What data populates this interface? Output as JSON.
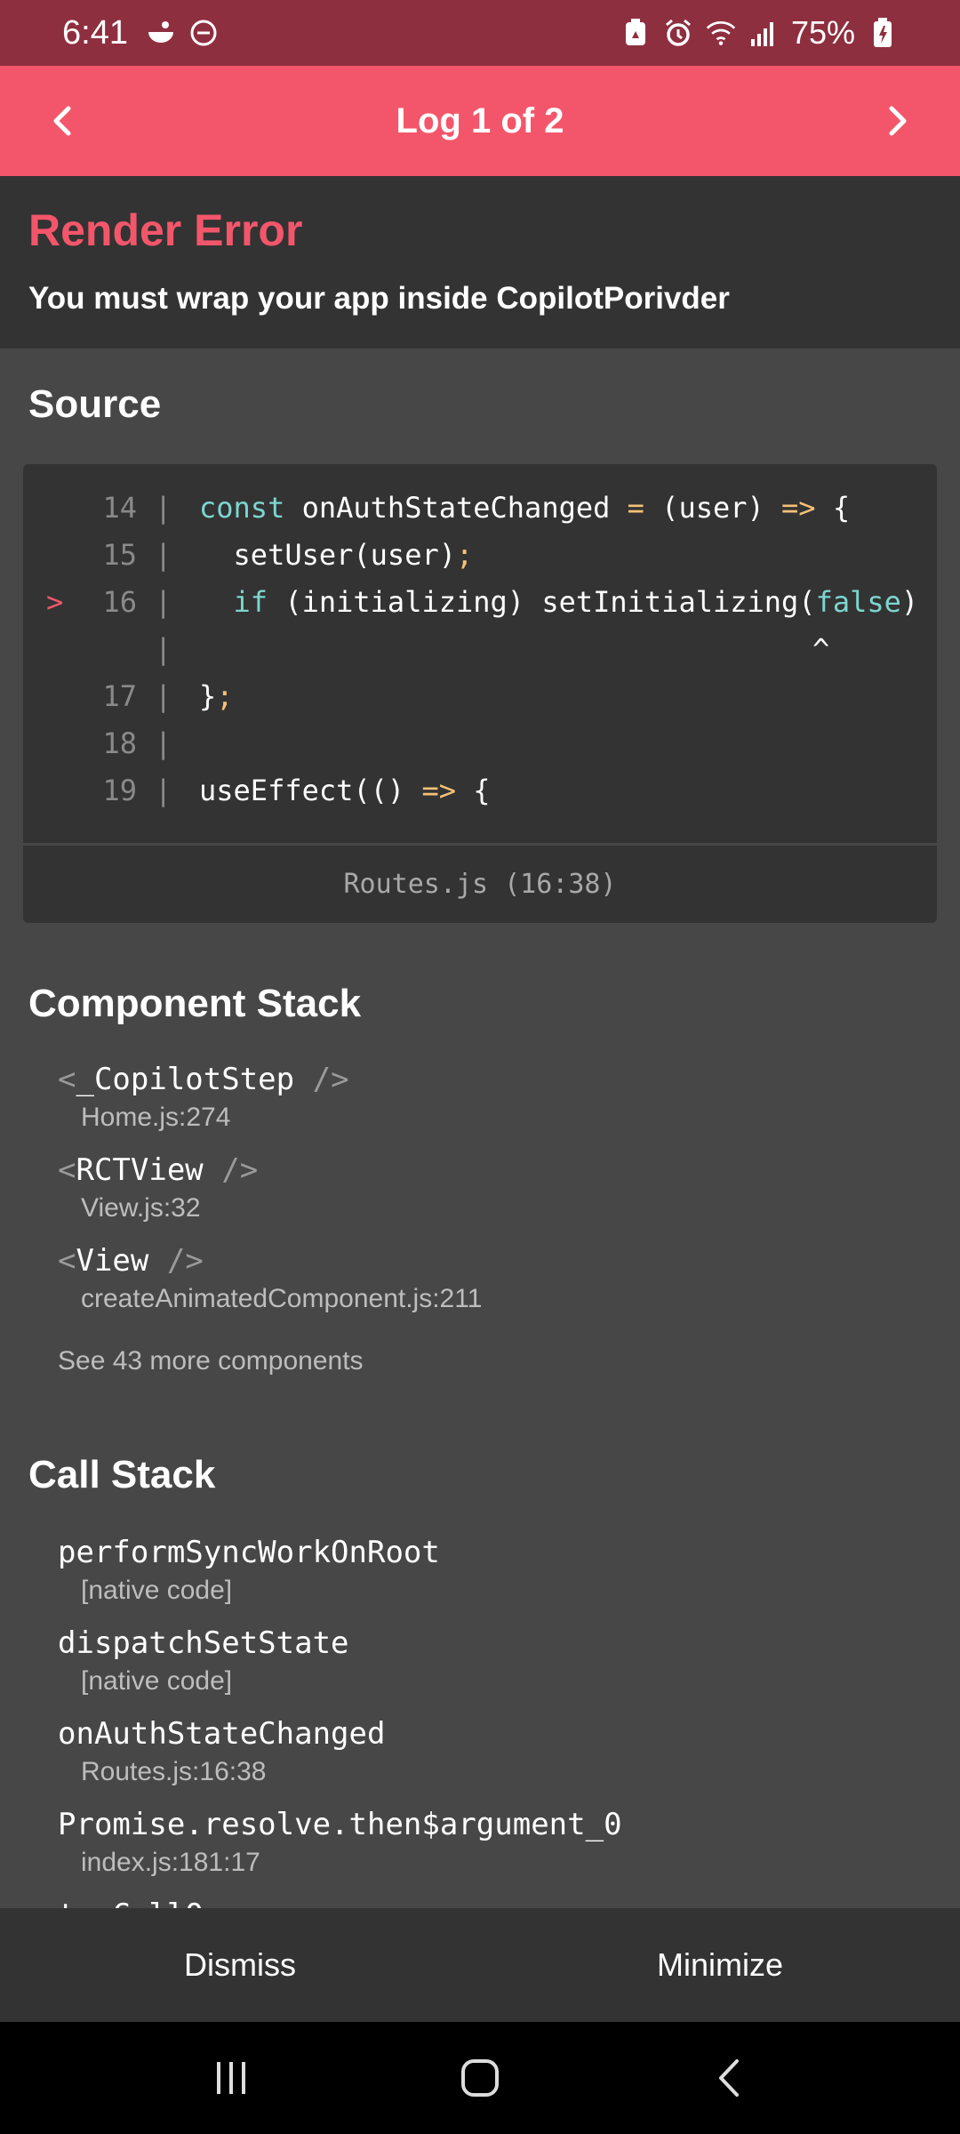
{
  "status_bar": {
    "time": "6:41",
    "battery": "75%",
    "left_icons": [
      "notification-icon",
      "do-not-disturb-icon"
    ],
    "right_icons": [
      "battery-saver-icon",
      "alarm-icon",
      "wifi-icon",
      "signal-icon",
      "battery-icon"
    ]
  },
  "header": {
    "title": "Log 1 of 2",
    "bg_color": "#f3566a"
  },
  "error": {
    "title": "Render Error",
    "message": "You must wrap your app inside CopilotPorivder"
  },
  "source": {
    "section_title": "Source",
    "lines": [
      {
        "num": "14",
        "marker": "",
        "code": "const onAuthStateChanged = (user) => {"
      },
      {
        "num": "15",
        "marker": "",
        "code": "  setUser(user);"
      },
      {
        "num": "16",
        "marker": ">",
        "code": "  if (initializing) setInitializing(false)"
      },
      {
        "num": "",
        "marker": "",
        "code": "^"
      },
      {
        "num": "17",
        "marker": "",
        "code": "};"
      },
      {
        "num": "18",
        "marker": "",
        "code": ""
      },
      {
        "num": "19",
        "marker": "",
        "code": "useEffect(() => {"
      }
    ],
    "location": "Routes.js (16:38)"
  },
  "component_stack": {
    "section_title": "Component Stack",
    "items": [
      {
        "name": "_CopilotStep",
        "file": "Home.js:274"
      },
      {
        "name": "RCTView",
        "file": "View.js:32"
      },
      {
        "name": "View",
        "file": "createAnimatedComponent.js:211"
      }
    ],
    "see_more": "See 43 more components"
  },
  "call_stack": {
    "section_title": "Call Stack",
    "items": [
      {
        "name": "performSyncWorkOnRoot",
        "file": "[native code]"
      },
      {
        "name": "dispatchSetState",
        "file": "[native code]"
      },
      {
        "name": "onAuthStateChanged",
        "file": "Routes.js:16:38"
      },
      {
        "name": "Promise.resolve.then$argument_0",
        "file": "index.js:181:17"
      },
      {
        "name": "tryCallO",
        "file": ""
      }
    ]
  },
  "actions": {
    "dismiss": "Dismiss",
    "minimize": "Minimize"
  }
}
